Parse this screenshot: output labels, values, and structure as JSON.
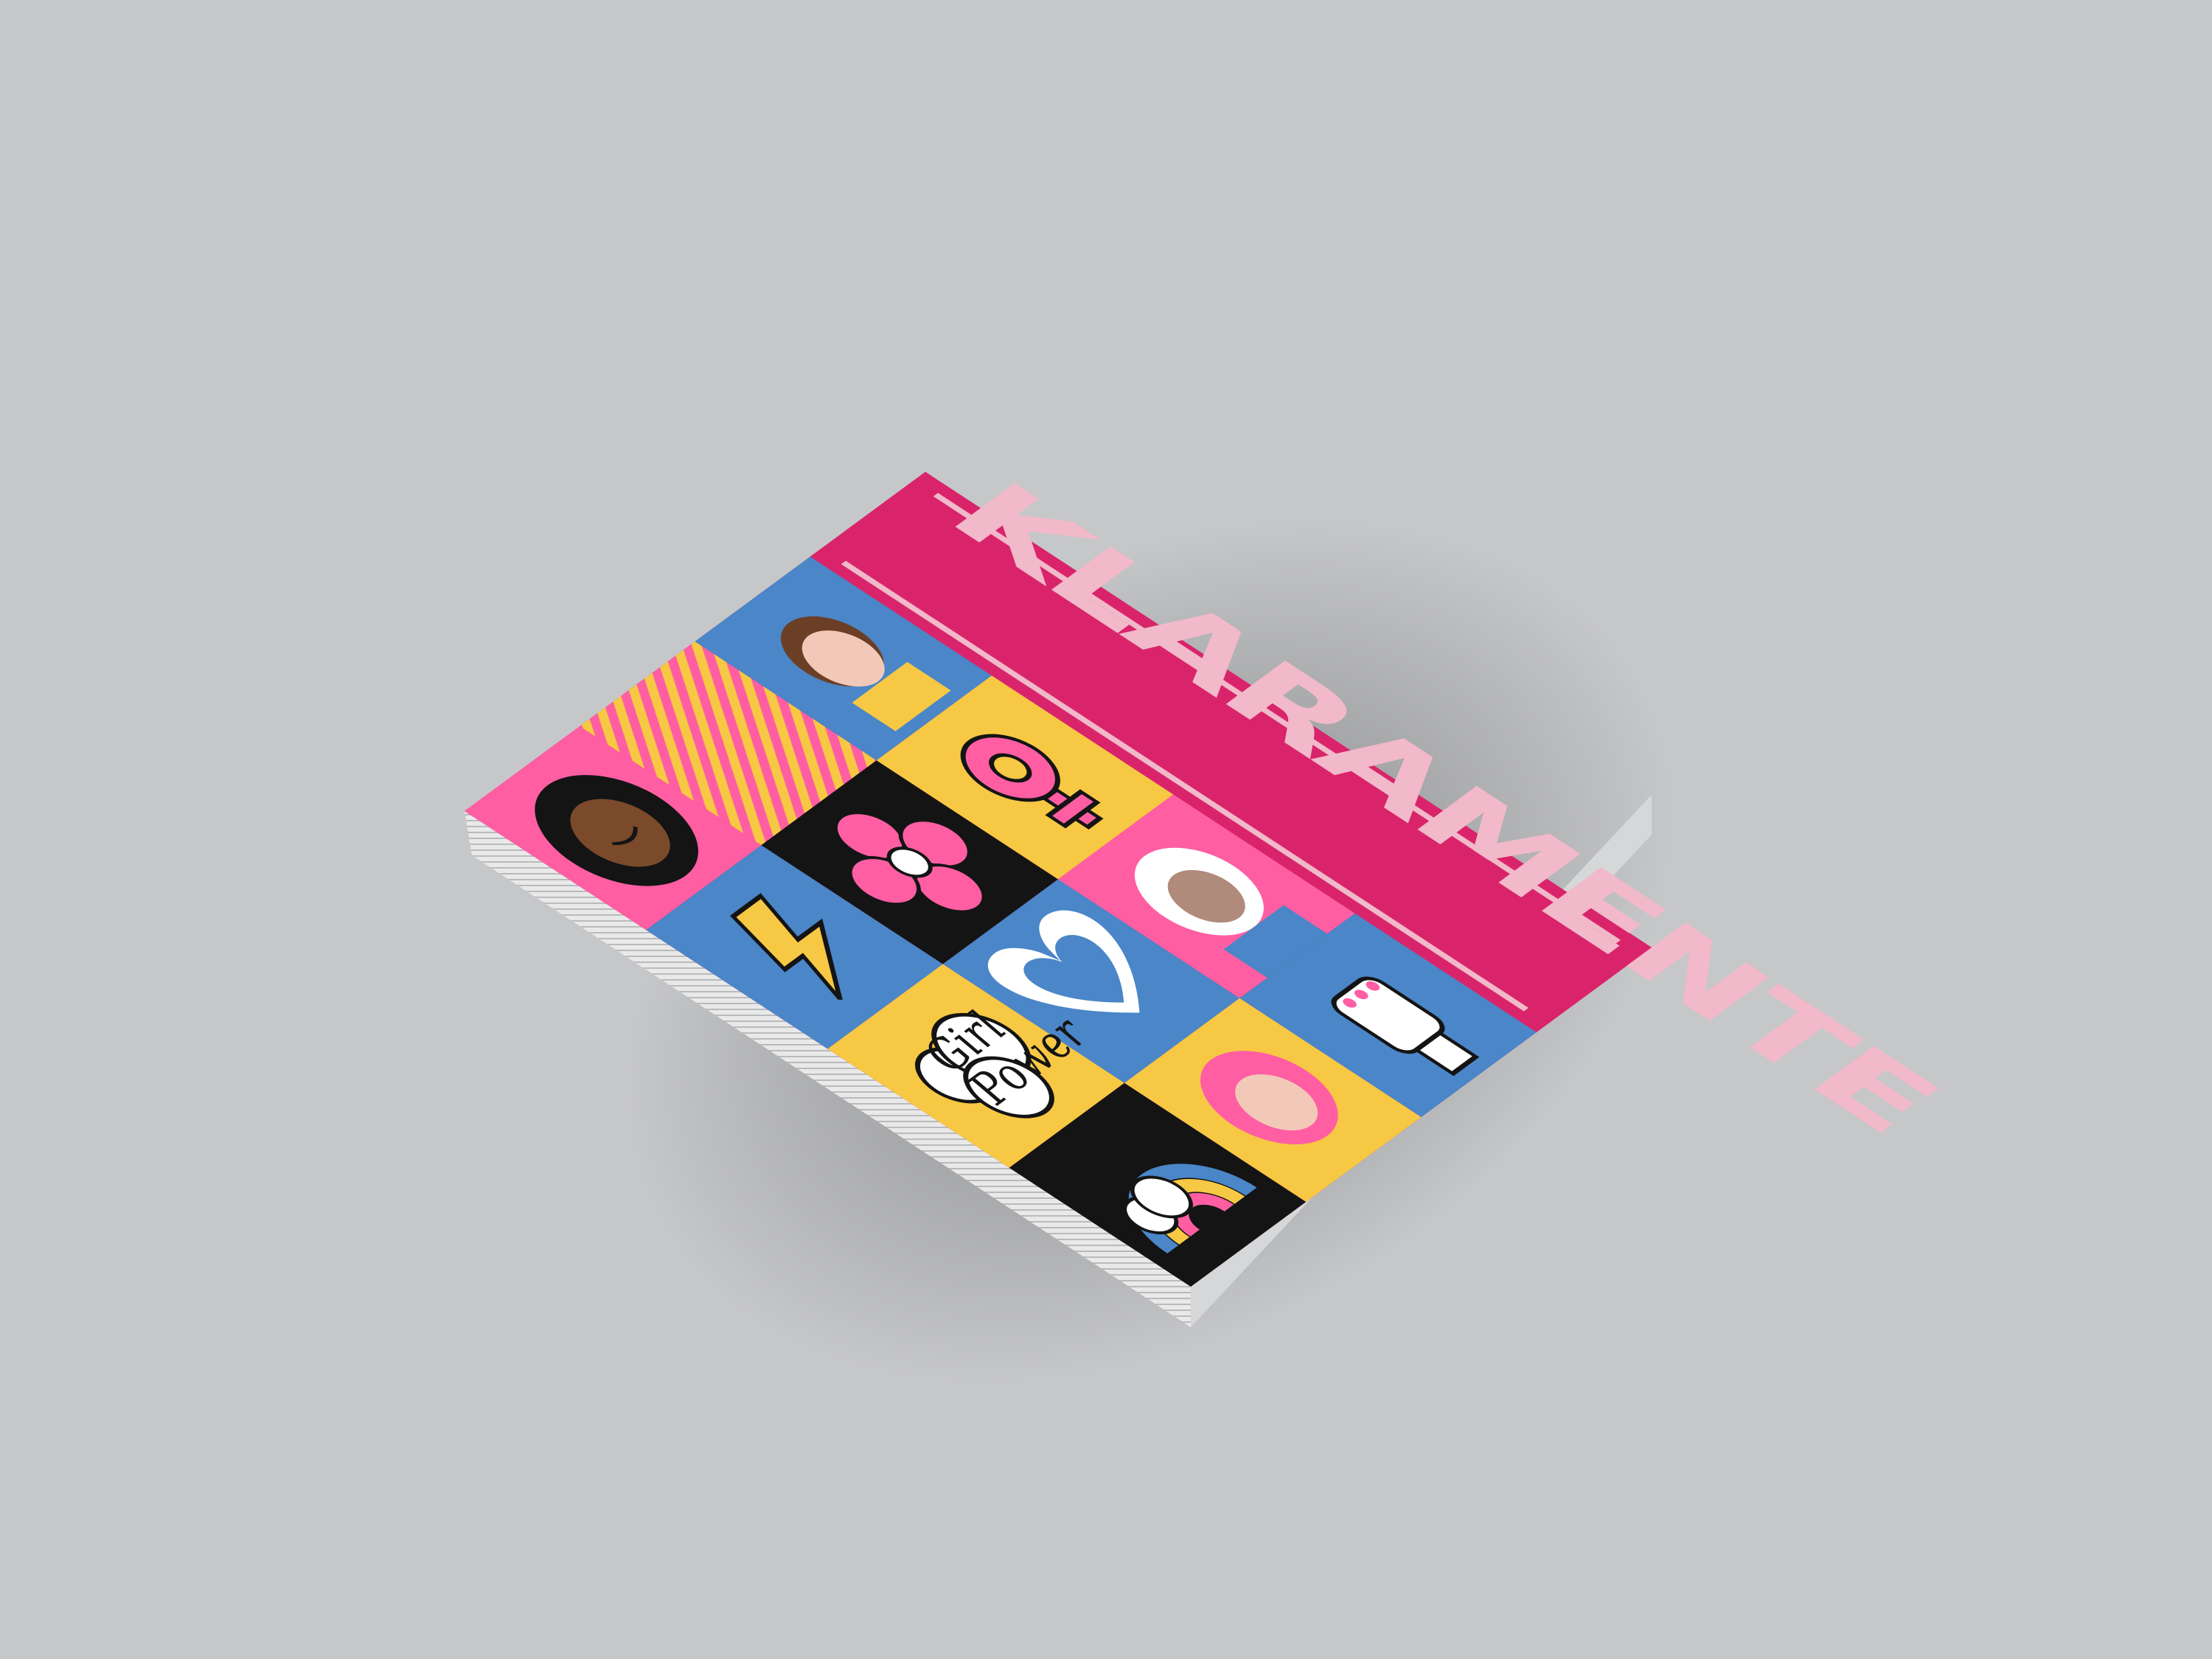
{
  "book": {
    "title": "KLARAMENTE",
    "badge": {
      "line1": "Girl",
      "line2": "Power"
    }
  },
  "colors": {
    "background": "#c6c7c9",
    "magenta": "#d9246b",
    "pink": "#ff5ea3",
    "blue": "#4a86c8",
    "yellow": "#f7c843",
    "black": "#141414",
    "title_fill": "#f1b9c9"
  },
  "icons": {
    "cell_a1": "boy-face-icon",
    "cell_a2": "stripes-pattern",
    "cell_a3": "girl-afro-face-icon",
    "cell_b1": "female-symbol-icon",
    "cell_b2": "flower-icon",
    "cell_b3": "lightning-bolt-icon",
    "cell_c1": "hijab-woman-face-icon",
    "cell_c2": "heart-icon",
    "cell_c3": "girl-power-cloud-icon",
    "cell_d1": "raised-fist-icon",
    "cell_d2": "pink-hair-girl-face-icon",
    "cell_d3": "rainbow-cloud-icon"
  }
}
